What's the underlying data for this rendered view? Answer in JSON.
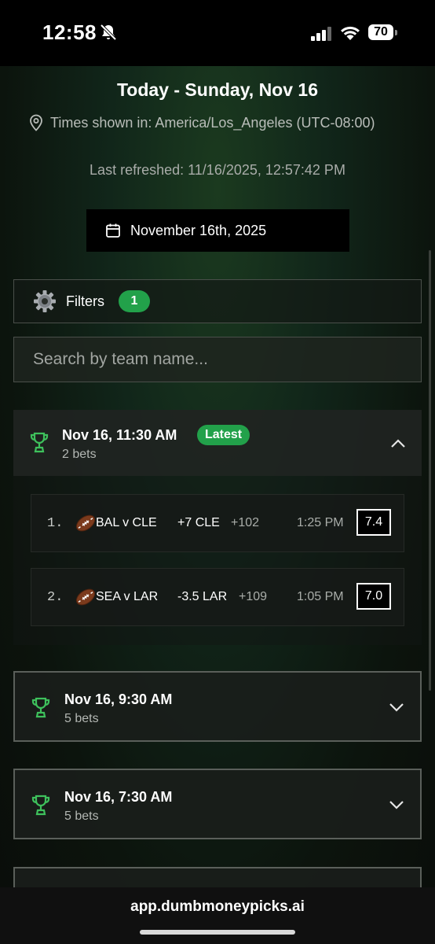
{
  "status": {
    "time": "12:58",
    "battery": "70"
  },
  "header": {
    "title": "Today - Sunday, Nov 16",
    "timezone": "Times shown in: America/Los_Angeles (UTC-08:00)",
    "last_refreshed": "Last refreshed: 11/16/2025, 12:57:42 PM",
    "date_picker": "November 16th, 2025"
  },
  "filters": {
    "label": "Filters",
    "count": "1"
  },
  "search": {
    "placeholder": "Search by team name..."
  },
  "groups": [
    {
      "time": "Nov 16, 11:30 AM",
      "badge": "Latest",
      "count": "2 bets",
      "expanded": true,
      "bets": [
        {
          "num": "1.",
          "match": "BAL v CLE",
          "line": "+7 CLE",
          "odds": "+102",
          "time": "1:25 PM",
          "score": "7.4",
          "sport_icon": "football-icon"
        },
        {
          "num": "2.",
          "match": "SEA v LAR",
          "line": "-3.5 LAR",
          "odds": "+109",
          "time": "1:05 PM",
          "score": "7.0",
          "sport_icon": "football-icon"
        }
      ]
    },
    {
      "time": "Nov 16, 9:30 AM",
      "count": "5 bets",
      "expanded": false
    },
    {
      "time": "Nov 16, 7:30 AM",
      "count": "5 bets",
      "expanded": false
    }
  ],
  "browser": {
    "url": "app.dumbmoneypicks.ai"
  },
  "colors": {
    "accent_green": "#22a14a",
    "trophy_green": "#3ec15c"
  }
}
